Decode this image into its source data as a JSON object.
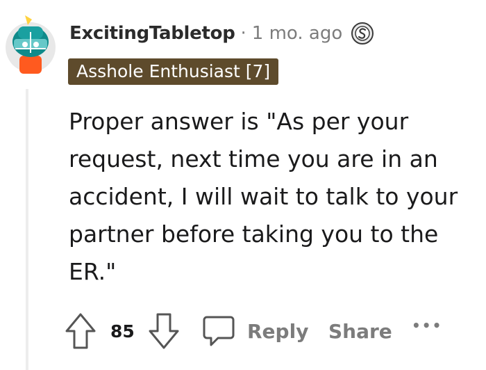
{
  "comment": {
    "username": "ExcitingTabletop",
    "separator": "·",
    "time": "1 mo. ago",
    "flair": "Asshole Enthusiast [7]",
    "body": "Proper answer is \"As per your request, next time you are in an accident, I will wait to talk to your partner before taking you to the ER.\""
  },
  "actions": {
    "vote_count": "85",
    "reply_label": "Reply",
    "share_label": "Share",
    "more_label": "•••"
  },
  "icons": {
    "avatar": "avatar-icon",
    "status": "s-badge-icon",
    "upvote": "arrow-up-icon",
    "downvote": "arrow-down-icon",
    "reply": "speech-bubble-icon",
    "more": "more-icon"
  },
  "colors": {
    "flair_bg": "#5e4b2c",
    "meta_text": "#7c7c7c",
    "thread_line": "#ededed"
  }
}
